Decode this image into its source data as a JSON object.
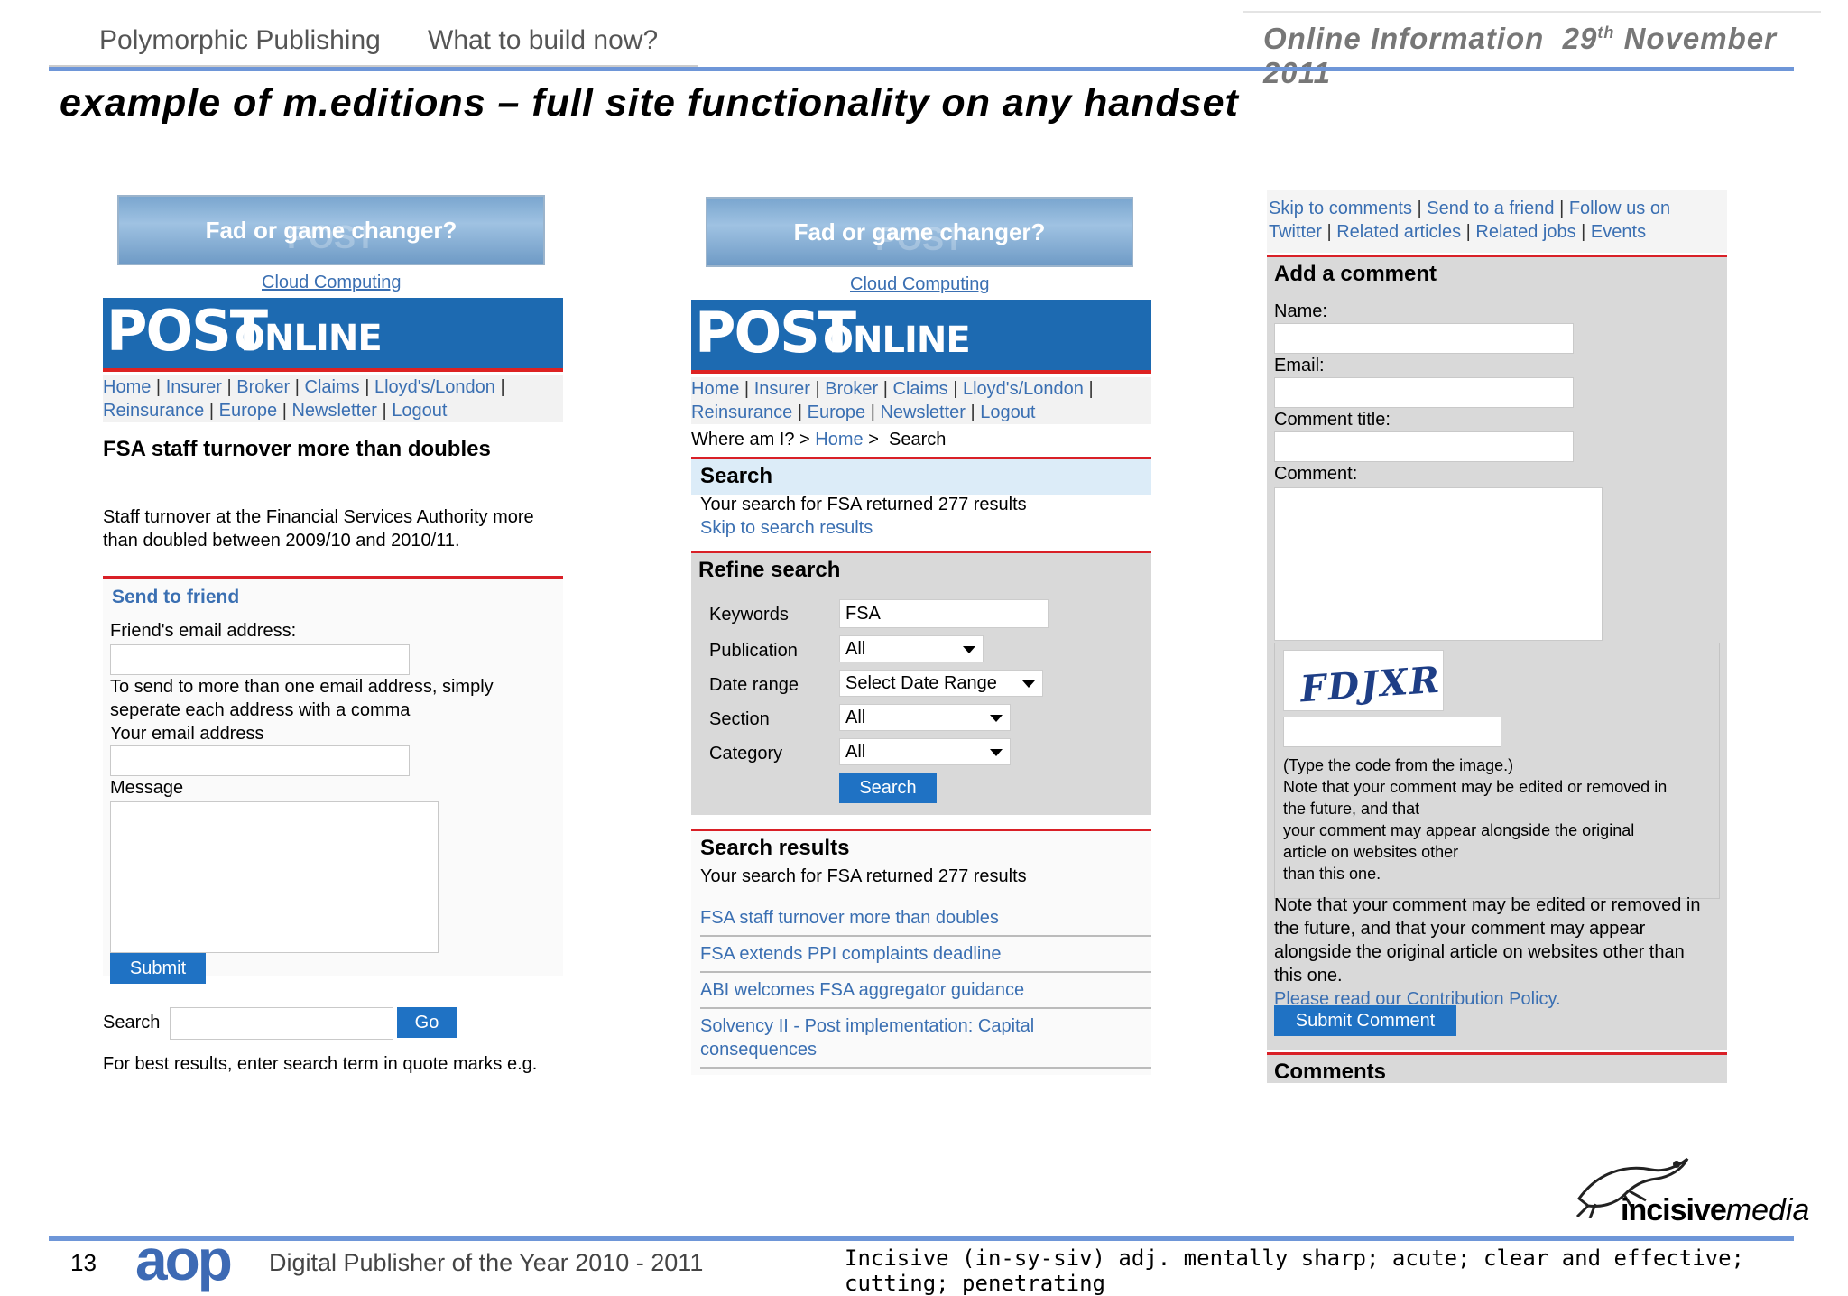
{
  "header": {
    "company": "Polymorphic Publishing",
    "subtitle": "What to build now?",
    "event_prefix": "Online Information",
    "event_day": "29",
    "event_day_suffix": "th",
    "event_month_year": "November 2011"
  },
  "slide_title": "example of m.editions – full site functionality on any handset",
  "phone1": {
    "banner": "Fad or game changer?",
    "banner_ghost": "POST",
    "cloud_link": "Cloud Computing",
    "logo_big": "POST",
    "logo_small": "ONLINE",
    "nav_row1": [
      "Home",
      "Insurer",
      "Broker",
      "Claims",
      "Lloyd's/London"
    ],
    "nav_row2": [
      "Reinsurance",
      "Europe",
      "Newsletter",
      "Logout"
    ],
    "article_title": "FSA staff turnover more than doubles",
    "article_line1": "Staff turnover at the Financial Services Authority more",
    "article_line2": "than doubled between 2009/10 and 2010/11.",
    "send_heading": "Send to friend",
    "friend_email_label": "Friend's email address:",
    "help_line1": "To send to more than one email address, simply",
    "help_line2": "seperate each address with a comma",
    "your_email_label": "Your email address",
    "message_label": "Message",
    "submit_label": "Submit",
    "search_label": "Search",
    "go_label": "Go",
    "search_hint": "For best results, enter search term in quote marks e.g."
  },
  "phone2": {
    "banner": "Fad or game changer?",
    "banner_ghost": "POST",
    "cloud_link": "Cloud Computing",
    "logo_big": "POST",
    "logo_small": "ONLINE",
    "nav_row1": [
      "Home",
      "Insurer",
      "Broker",
      "Claims",
      "Lloyd's/London"
    ],
    "nav_row2": [
      "Reinsurance",
      "Europe",
      "Newsletter",
      "Logout"
    ],
    "where_label": "Where am I? >",
    "where_home": "Home",
    "where_sep": ">",
    "where_current": "Search",
    "search_heading": "Search",
    "search_summary": "Your search for FSA returned 277 results",
    "skip_link": "Skip to search results",
    "refine_heading": "Refine search",
    "fields": [
      {
        "label": "Keywords",
        "value": "FSA"
      },
      {
        "label": "Publication",
        "value": "All"
      },
      {
        "label": "Date range",
        "value": "Select Date Range"
      },
      {
        "label": "Section",
        "value": "All"
      },
      {
        "label": "Category",
        "value": "All"
      }
    ],
    "search_button": "Search",
    "results_heading": "Search results",
    "results_summary": "Your search for FSA returned 277 results",
    "results": [
      "FSA staff turnover more than doubles",
      "FSA extends PPI complaints deadline",
      "ABI welcomes FSA aggregator guidance",
      "Solvency II - Post implementation: Capital",
      "consequences"
    ]
  },
  "phone3": {
    "top_links_row1": [
      "Skip to comments",
      "Send to a friend",
      "Follow us on"
    ],
    "top_links_row2": [
      "Twitter",
      "Related articles",
      "Related jobs",
      "Events"
    ],
    "add_comment_heading": "Add a comment",
    "name_label": "Name:",
    "email_label": "Email:",
    "comment_title_label": "Comment title:",
    "comment_label": "Comment:",
    "captcha_text": "FDJXR",
    "captcha_instructions": [
      "(Type the code from the image.)",
      "Note that your comment may be edited or removed in",
      "the future, and that",
      "your comment may appear alongside the original",
      "article on websites other",
      "than this one."
    ],
    "note_lines": [
      "Note that your comment may be edited or removed in",
      "the future, and that your comment may appear",
      "alongside the original article on websites other than",
      "this one."
    ],
    "policy_link": "Please read our Contribution Policy.",
    "submit_comment": "Submit Comment",
    "comments_heading": "Comments"
  },
  "footer": {
    "page_number": "13",
    "aop_logo": "aop",
    "award": "Digital Publisher of the Year 2010 - 2011",
    "definition": "Incisive (in-sy-siv) adj. mentally sharp; acute; clear and effective; cutting; penetrating",
    "brand_bold": "incisive",
    "brand_italic": "media"
  },
  "colors": {
    "accent_blue": "#6e96d8",
    "logo_blue": "#1d6ab1",
    "link_blue": "#3a6fb2",
    "red_rule": "#d92027"
  }
}
